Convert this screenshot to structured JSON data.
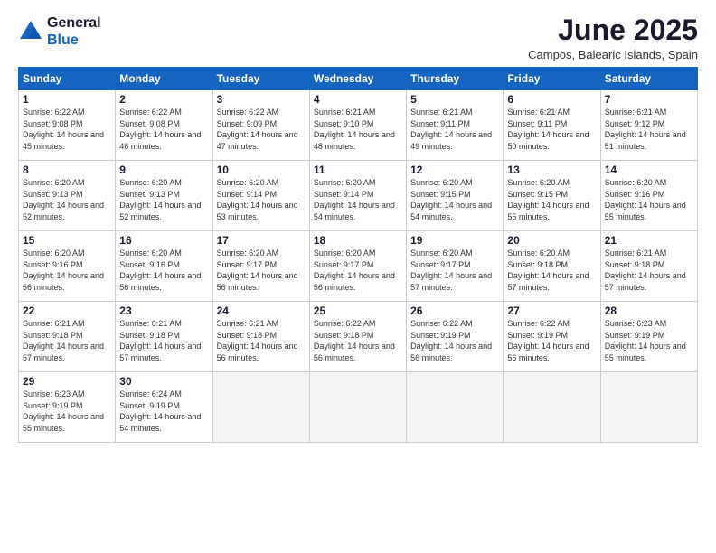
{
  "logo": {
    "general": "General",
    "blue": "Blue"
  },
  "title": "June 2025",
  "location": "Campos, Balearic Islands, Spain",
  "days_of_week": [
    "Sunday",
    "Monday",
    "Tuesday",
    "Wednesday",
    "Thursday",
    "Friday",
    "Saturday"
  ],
  "weeks": [
    [
      {
        "day": "1",
        "sunrise": "6:22 AM",
        "sunset": "9:08 PM",
        "daylight": "14 hours and 45 minutes."
      },
      {
        "day": "2",
        "sunrise": "6:22 AM",
        "sunset": "9:08 PM",
        "daylight": "14 hours and 46 minutes."
      },
      {
        "day": "3",
        "sunrise": "6:22 AM",
        "sunset": "9:09 PM",
        "daylight": "14 hours and 47 minutes."
      },
      {
        "day": "4",
        "sunrise": "6:21 AM",
        "sunset": "9:10 PM",
        "daylight": "14 hours and 48 minutes."
      },
      {
        "day": "5",
        "sunrise": "6:21 AM",
        "sunset": "9:11 PM",
        "daylight": "14 hours and 49 minutes."
      },
      {
        "day": "6",
        "sunrise": "6:21 AM",
        "sunset": "9:11 PM",
        "daylight": "14 hours and 50 minutes."
      },
      {
        "day": "7",
        "sunrise": "6:21 AM",
        "sunset": "9:12 PM",
        "daylight": "14 hours and 51 minutes."
      }
    ],
    [
      {
        "day": "8",
        "sunrise": "6:20 AM",
        "sunset": "9:13 PM",
        "daylight": "14 hours and 52 minutes."
      },
      {
        "day": "9",
        "sunrise": "6:20 AM",
        "sunset": "9:13 PM",
        "daylight": "14 hours and 52 minutes."
      },
      {
        "day": "10",
        "sunrise": "6:20 AM",
        "sunset": "9:14 PM",
        "daylight": "14 hours and 53 minutes."
      },
      {
        "day": "11",
        "sunrise": "6:20 AM",
        "sunset": "9:14 PM",
        "daylight": "14 hours and 54 minutes."
      },
      {
        "day": "12",
        "sunrise": "6:20 AM",
        "sunset": "9:15 PM",
        "daylight": "14 hours and 54 minutes."
      },
      {
        "day": "13",
        "sunrise": "6:20 AM",
        "sunset": "9:15 PM",
        "daylight": "14 hours and 55 minutes."
      },
      {
        "day": "14",
        "sunrise": "6:20 AM",
        "sunset": "9:16 PM",
        "daylight": "14 hours and 55 minutes."
      }
    ],
    [
      {
        "day": "15",
        "sunrise": "6:20 AM",
        "sunset": "9:16 PM",
        "daylight": "14 hours and 56 minutes."
      },
      {
        "day": "16",
        "sunrise": "6:20 AM",
        "sunset": "9:16 PM",
        "daylight": "14 hours and 56 minutes."
      },
      {
        "day": "17",
        "sunrise": "6:20 AM",
        "sunset": "9:17 PM",
        "daylight": "14 hours and 56 minutes."
      },
      {
        "day": "18",
        "sunrise": "6:20 AM",
        "sunset": "9:17 PM",
        "daylight": "14 hours and 56 minutes."
      },
      {
        "day": "19",
        "sunrise": "6:20 AM",
        "sunset": "9:17 PM",
        "daylight": "14 hours and 57 minutes."
      },
      {
        "day": "20",
        "sunrise": "6:20 AM",
        "sunset": "9:18 PM",
        "daylight": "14 hours and 57 minutes."
      },
      {
        "day": "21",
        "sunrise": "6:21 AM",
        "sunset": "9:18 PM",
        "daylight": "14 hours and 57 minutes."
      }
    ],
    [
      {
        "day": "22",
        "sunrise": "6:21 AM",
        "sunset": "9:18 PM",
        "daylight": "14 hours and 57 minutes."
      },
      {
        "day": "23",
        "sunrise": "6:21 AM",
        "sunset": "9:18 PM",
        "daylight": "14 hours and 57 minutes."
      },
      {
        "day": "24",
        "sunrise": "6:21 AM",
        "sunset": "9:18 PM",
        "daylight": "14 hours and 56 minutes."
      },
      {
        "day": "25",
        "sunrise": "6:22 AM",
        "sunset": "9:18 PM",
        "daylight": "14 hours and 56 minutes."
      },
      {
        "day": "26",
        "sunrise": "6:22 AM",
        "sunset": "9:19 PM",
        "daylight": "14 hours and 56 minutes."
      },
      {
        "day": "27",
        "sunrise": "6:22 AM",
        "sunset": "9:19 PM",
        "daylight": "14 hours and 56 minutes."
      },
      {
        "day": "28",
        "sunrise": "6:23 AM",
        "sunset": "9:19 PM",
        "daylight": "14 hours and 55 minutes."
      }
    ],
    [
      {
        "day": "29",
        "sunrise": "6:23 AM",
        "sunset": "9:19 PM",
        "daylight": "14 hours and 55 minutes."
      },
      {
        "day": "30",
        "sunrise": "6:24 AM",
        "sunset": "9:19 PM",
        "daylight": "14 hours and 54 minutes."
      },
      null,
      null,
      null,
      null,
      null
    ]
  ]
}
